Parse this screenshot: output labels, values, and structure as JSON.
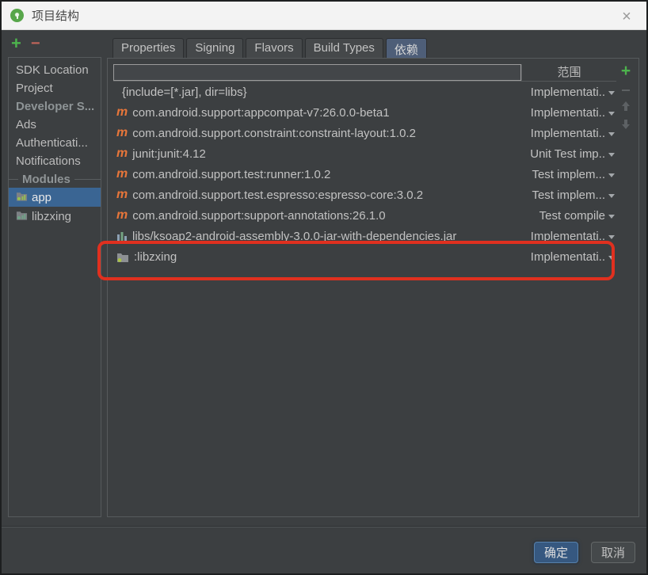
{
  "window": {
    "title": "项目结构",
    "close_glyph": "×"
  },
  "sidebar": {
    "add_glyph": "+",
    "remove_glyph": "−",
    "items": [
      {
        "label": "SDK Location",
        "style": "normal"
      },
      {
        "label": "Project",
        "style": "normal"
      },
      {
        "label": "Developer S...",
        "style": "dim"
      },
      {
        "label": "Ads",
        "style": "normal"
      },
      {
        "label": "Authenticati...",
        "style": "normal"
      },
      {
        "label": "Notifications",
        "style": "normal"
      }
    ],
    "modules_header": "Modules",
    "modules": [
      {
        "label": "app",
        "selected": true,
        "icon": "android-module-icon"
      },
      {
        "label": "libzxing",
        "selected": false,
        "icon": "library-module-icon"
      }
    ]
  },
  "tabs": [
    {
      "label": "Properties",
      "selected": false
    },
    {
      "label": "Signing",
      "selected": false
    },
    {
      "label": "Flavors",
      "selected": false
    },
    {
      "label": "Build Types",
      "selected": false
    },
    {
      "label": "依赖",
      "selected": true
    }
  ],
  "table": {
    "scope_header": "范围",
    "rows": [
      {
        "icon": "none",
        "name": "{include=[*.jar], dir=libs}",
        "scope": "Implementati..",
        "highlighted": false
      },
      {
        "icon": "maven",
        "name": "com.android.support:appcompat-v7:26.0.0-beta1",
        "scope": "Implementati..",
        "highlighted": false
      },
      {
        "icon": "maven",
        "name": "com.android.support.constraint:constraint-layout:1.0.2",
        "scope": "Implementati..",
        "highlighted": false
      },
      {
        "icon": "maven",
        "name": "junit:junit:4.12",
        "scope": "Unit Test imp..",
        "highlighted": false
      },
      {
        "icon": "maven",
        "name": "com.android.support.test:runner:1.0.2",
        "scope": "Test implem...",
        "highlighted": false
      },
      {
        "icon": "maven",
        "name": "com.android.support.test.espresso:espresso-core:3.0.2",
        "scope": "Test implem...",
        "highlighted": false
      },
      {
        "icon": "maven",
        "name": "com.android.support:support-annotations:26.1.0",
        "scope": "Test compile",
        "highlighted": false
      },
      {
        "icon": "library",
        "name": "libs/ksoap2-android-assembly-3.0.0-jar-with-dependencies.jar",
        "scope": "Implementati..",
        "highlighted": false
      },
      {
        "icon": "module",
        "name": ":libzxing",
        "scope": "Implementati..",
        "highlighted": true
      }
    ]
  },
  "mini_toolbar": {
    "add_glyph": "+"
  },
  "footer": {
    "ok_label": "确定",
    "cancel_label": "取消"
  },
  "colors": {
    "accent_green": "#4db34d",
    "remove_red": "#c0655a",
    "maven_orange": "#e8763a",
    "selection_blue": "#3a6593",
    "selected_tab": "#4e5e78",
    "annotation_red": "#e0301f",
    "ok_button_blue": "#365880",
    "titlebar_icon_green": "#57a64a"
  }
}
